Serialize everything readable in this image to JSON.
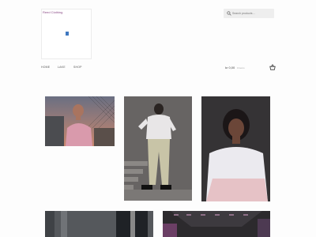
{
  "site": {
    "title": "Reed Clothing"
  },
  "search": {
    "placeholder": "Search products…",
    "icon": "search-icon"
  },
  "nav": {
    "items": [
      {
        "label": "HOME"
      },
      {
        "label": "LAKE"
      },
      {
        "label": "SHOP"
      }
    ]
  },
  "cart": {
    "total": "kr 0,00",
    "count": "0 items",
    "icon": "basket-icon"
  },
  "gallery": {
    "images": [
      {
        "name": "portrait-pink-sweatshirt-fence"
      },
      {
        "name": "model-white-top-khaki-pants"
      },
      {
        "name": "portrait-white-pink-sweatshirt"
      },
      {
        "name": "concrete-wall-photo"
      },
      {
        "name": "subway-station-photo"
      }
    ]
  },
  "colors": {
    "brand": "#8a4a86",
    "search_bg": "#eeeeee",
    "background": "#fdfdfd"
  }
}
